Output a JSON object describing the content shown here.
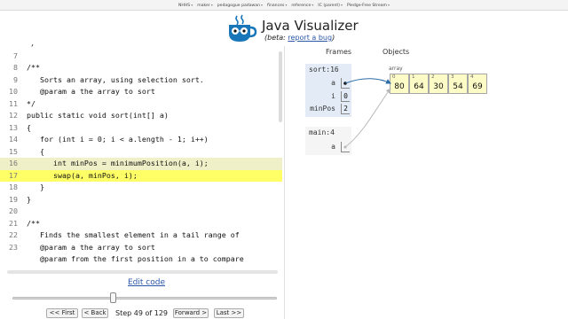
{
  "bookmarks": [
    "NHHS",
    "maker",
    "pedagogue padawan",
    "finances",
    "reference",
    "IC (parent)",
    "Pledge-Free Stream"
  ],
  "header": {
    "title": "Java Visualizer",
    "beta_prefix": "(beta: ",
    "report_link": "report a bug",
    "beta_suffix": ")"
  },
  "code": {
    "lines": [
      {
        "num": "",
        "text": "*/"
      },
      {
        "num": "7",
        "text": ""
      },
      {
        "num": "8",
        "text": "/**"
      },
      {
        "num": "9",
        "text": "   Sorts an array, using selection sort."
      },
      {
        "num": "10",
        "text": "   @param a the array to sort"
      },
      {
        "num": "11",
        "text": "*/"
      },
      {
        "num": "12",
        "text": "public static void sort(int[] a)"
      },
      {
        "num": "13",
        "text": "{"
      },
      {
        "num": "14",
        "text": "   for (int i = 0; i < a.length - 1; i++)"
      },
      {
        "num": "15",
        "text": "   {"
      },
      {
        "num": "16",
        "text": "      int minPos = minimumPosition(a, i);"
      },
      {
        "num": "17",
        "text": "      swap(a, minPos, i);"
      },
      {
        "num": "18",
        "text": "   }"
      },
      {
        "num": "19",
        "text": "}"
      },
      {
        "num": "20",
        "text": ""
      },
      {
        "num": "21",
        "text": "/**"
      },
      {
        "num": "22",
        "text": "   Finds the smallest element in a tail range of"
      },
      {
        "num": "23",
        "text": "   @param a the array to sort"
      },
      {
        "num": "",
        "text": "   @param from the first position in a to compare"
      }
    ],
    "prev_line_index": 10,
    "current_line_index": 11
  },
  "controls": {
    "edit_code": "Edit code",
    "first": "<< First",
    "back": "< Back",
    "step_text": "Step 49 of 129",
    "forward": "Forward >",
    "last": "Last >>",
    "slider_fraction": 0.38
  },
  "viz": {
    "frames_heading": "Frames",
    "objects_heading": "Objects",
    "frames": [
      {
        "name": "sort:16",
        "active": true,
        "vars": [
          {
            "name": "a",
            "value": ""
          },
          {
            "name": "i",
            "value": "0"
          },
          {
            "name": "minPos",
            "value": "2"
          }
        ]
      },
      {
        "name": "main:4",
        "active": false,
        "vars": [
          {
            "name": "a",
            "value": ""
          }
        ]
      }
    ],
    "array_label": "array",
    "array": [
      {
        "idx": "0",
        "val": "80"
      },
      {
        "idx": "1",
        "val": "64"
      },
      {
        "idx": "2",
        "val": "30"
      },
      {
        "idx": "3",
        "val": "54"
      },
      {
        "idx": "4",
        "val": "69"
      }
    ]
  },
  "colors": {
    "current_line": "#ffff66",
    "prev_line": "#f0f0c8",
    "frame_bg": "#e2ebf6",
    "array_cell": "#fdfcc6",
    "pointer_active": "#2b6ca6",
    "pointer_inactive": "#b8b8b8"
  }
}
